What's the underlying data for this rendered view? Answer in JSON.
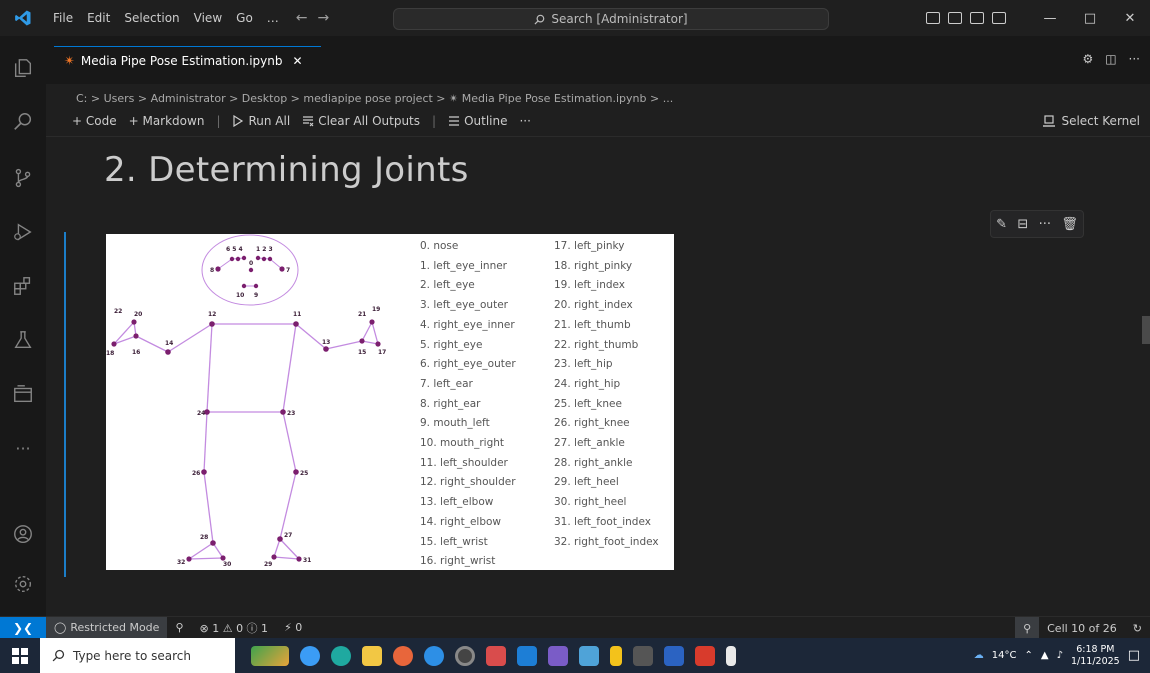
{
  "titlebar": {
    "menu": [
      "File",
      "Edit",
      "Selection",
      "View",
      "Go",
      "…"
    ],
    "search_text": "Search [Administrator]",
    "min": "—",
    "max": "□",
    "close": "✕"
  },
  "tab": {
    "label": "Media Pipe Pose Estimation.ipynb",
    "close": "✕"
  },
  "breadcrumb": "C: > Users > Administrator > Desktop > mediapipe pose project > ✴ Media Pipe Pose Estimation.ipynb > ...",
  "toolbar": {
    "code": "+ Code",
    "markdown": "+ Markdown",
    "run_all": "Run All",
    "clear_outputs": "Clear All Outputs",
    "outline": "Outline",
    "more": "···",
    "select_kernel": "Select Kernel"
  },
  "heading": "2. Determining Joints",
  "cell_actions": {
    "more": "···"
  },
  "figure": {
    "landmarks_col1": [
      "0. nose",
      "1. left_eye_inner",
      "2. left_eye",
      "3. left_eye_outer",
      "4. right_eye_inner",
      "5. right_eye",
      "6. right_eye_outer",
      "7. left_ear",
      "8. right_ear",
      "9. mouth_left",
      "10. mouth_right",
      "11. left_shoulder",
      "12. right_shoulder",
      "13. left_elbow",
      "14. right_elbow",
      "15. left_wrist",
      "16. right_wrist"
    ],
    "landmarks_col2": [
      "17. left_pinky",
      "18. right_pinky",
      "19. left_index",
      "20. right_index",
      "21. left_thumb",
      "22. right_thumb",
      "23. left_hip",
      "24. right_hip",
      "25. left_knee",
      "26. right_knee",
      "27. left_ankle",
      "28. right_ankle",
      "29. left_heel",
      "30. right_heel",
      "31. left_foot_index",
      "32. right_foot_index"
    ],
    "point_labels": {
      "head_right": "6 5 4",
      "head_left": "1 2 3",
      "p8": "8",
      "p7": "7",
      "p0": "0",
      "p10": "10",
      "p9": "9",
      "p12": "12",
      "p11": "11",
      "p22": "22",
      "p20": "20",
      "p18": "18",
      "p16": "16",
      "p14": "14",
      "p21": "21",
      "p19": "19",
      "p13": "13",
      "p15": "15",
      "p17": "17",
      "p24": "24",
      "p23": "23",
      "p26": "26",
      "p25": "25",
      "p28": "28",
      "p27": "27",
      "p32": "32",
      "p30": "30",
      "p29": "29",
      "p31": "31"
    }
  },
  "statusbar": {
    "restricted": "Restricted Mode",
    "problems": "⊗ 1 ⚠ 0 ⓘ 1",
    "ports": "⚡ 0",
    "cell": "Cell 10 of 26"
  },
  "taskbar": {
    "search_placeholder": "Type here to search",
    "weather": "14°C",
    "time": "6:18 PM",
    "date": "1/11/2025"
  },
  "colors": {
    "accent": "#0078d4",
    "joint": "#7b1f6e",
    "bone": "#c38be0"
  }
}
